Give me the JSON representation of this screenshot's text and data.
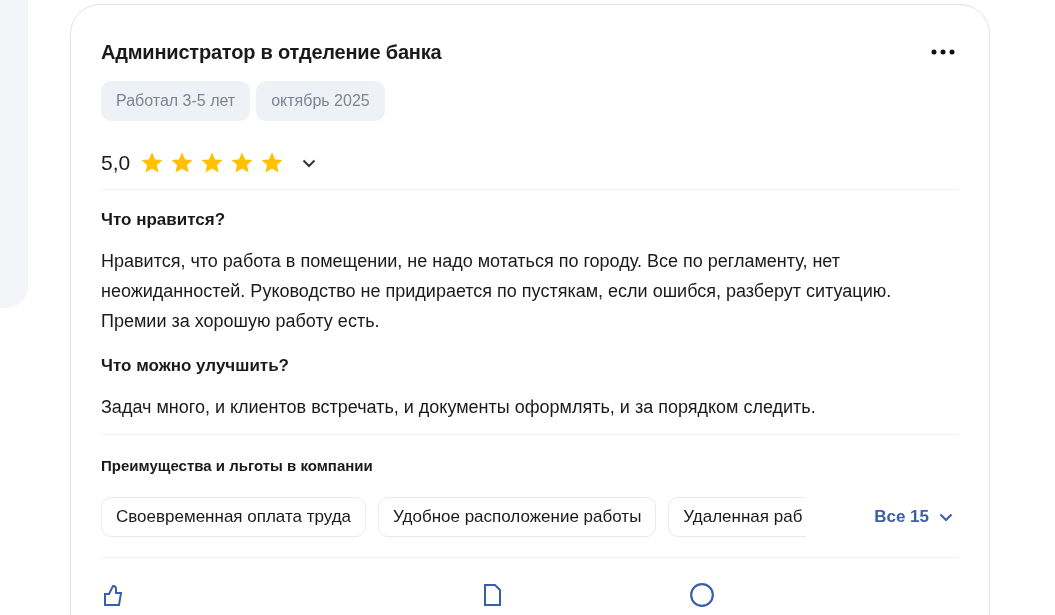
{
  "review": {
    "title": "Администратор в отделение банка",
    "tags": [
      "Работал 3-5 лет",
      "октябрь 2025"
    ],
    "rating": "5,0",
    "stars": 5,
    "sections": [
      {
        "heading": "Что нравится?",
        "text": "Нравится, что работа в помещении, не надо мотаться по городу. Все по регламенту, нет неожиданностей. Руководство не придирается по пустякам, если ошибся, разберут ситуацию. Премии за хорошую работу есть."
      },
      {
        "heading": "Что можно улучшить?",
        "text": "Задач много, и клиентов встречать, и документы оформлять, и за порядком следить."
      }
    ],
    "benefits": {
      "heading": "Преимущества и льготы в компании",
      "items": [
        "Своевременная оплата труда",
        "Удобное расположение работы",
        "Удаленная раб"
      ],
      "more": "Все 15"
    }
  }
}
